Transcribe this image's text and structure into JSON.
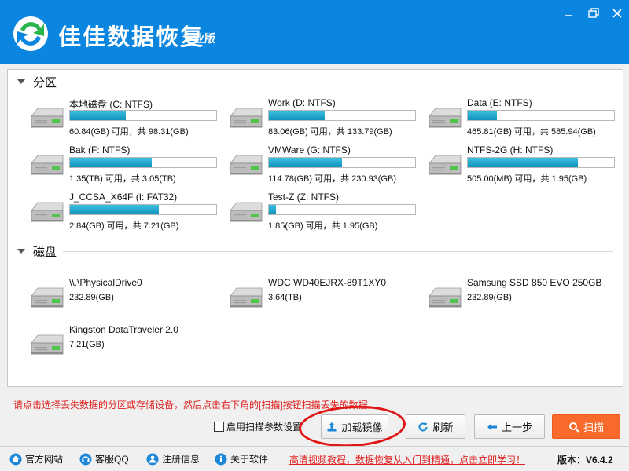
{
  "app": {
    "title": "佳佳数据恢复",
    "subtitle": "专业版"
  },
  "sections": {
    "partitions": "分区",
    "disks": "磁盘"
  },
  "partitions": [
    {
      "name": "本地磁盘 (C: NTFS)",
      "info": "60.84(GB) 可用，共 98.31(GB)",
      "used_fraction": 0.38
    },
    {
      "name": "Work (D: NTFS)",
      "info": "83.06(GB) 可用，共 133.79(GB)",
      "used_fraction": 0.38
    },
    {
      "name": "Data (E: NTFS)",
      "info": "465.81(GB) 可用，共 585.94(GB)",
      "used_fraction": 0.2
    },
    {
      "name": "Bak (F: NTFS)",
      "info": "1.35(TB) 可用，共 3.05(TB)",
      "used_fraction": 0.56
    },
    {
      "name": "VMWare (G: NTFS)",
      "info": "114.78(GB) 可用，共 230.93(GB)",
      "used_fraction": 0.5
    },
    {
      "name": "NTFS-2G (H: NTFS)",
      "info": "505.00(MB) 可用，共 1.95(GB)",
      "used_fraction": 0.75
    },
    {
      "name": "J_CCSA_X64F (I: FAT32)",
      "info": "2.84(GB) 可用，共 7.21(GB)",
      "used_fraction": 0.61
    },
    {
      "name": "Test-Z (Z: NTFS)",
      "info": "1.85(GB) 可用，共 1.95(GB)",
      "used_fraction": 0.05
    }
  ],
  "disks": [
    {
      "name": "\\\\.\\PhysicalDrive0",
      "size": "232.89(GB)"
    },
    {
      "name": "WDC WD40EJRX-89T1XY0",
      "size": "3.64(TB)"
    },
    {
      "name": "Samsung SSD 850 EVO 250GB",
      "size": "232.89(GB)"
    },
    {
      "name": "Kingston DataTraveler 2.0",
      "size": "7.21(GB)"
    }
  ],
  "footer": {
    "hint": "请点击选择丢失数据的分区或存储设备，然后点击右下角的[扫描]按钮扫描丢失的数据。",
    "scan_params_label": "启用扫描参数设置",
    "load_image": "加载镜像",
    "refresh": "刷新",
    "back": "上一步",
    "scan": "扫描"
  },
  "statusbar": {
    "website": "官方网站",
    "qq": "客服QQ",
    "register": "注册信息",
    "about": "关于软件",
    "tutorial_link": "高清视频教程，数据恢复从入门到精通，点击立即学习！",
    "version": "版本：V6.4.2"
  },
  "colors": {
    "title_bar": "#0b86e0",
    "progress": "#1aa4cf",
    "scan_button": "#f86a2b",
    "hint_text": "#e02020"
  }
}
